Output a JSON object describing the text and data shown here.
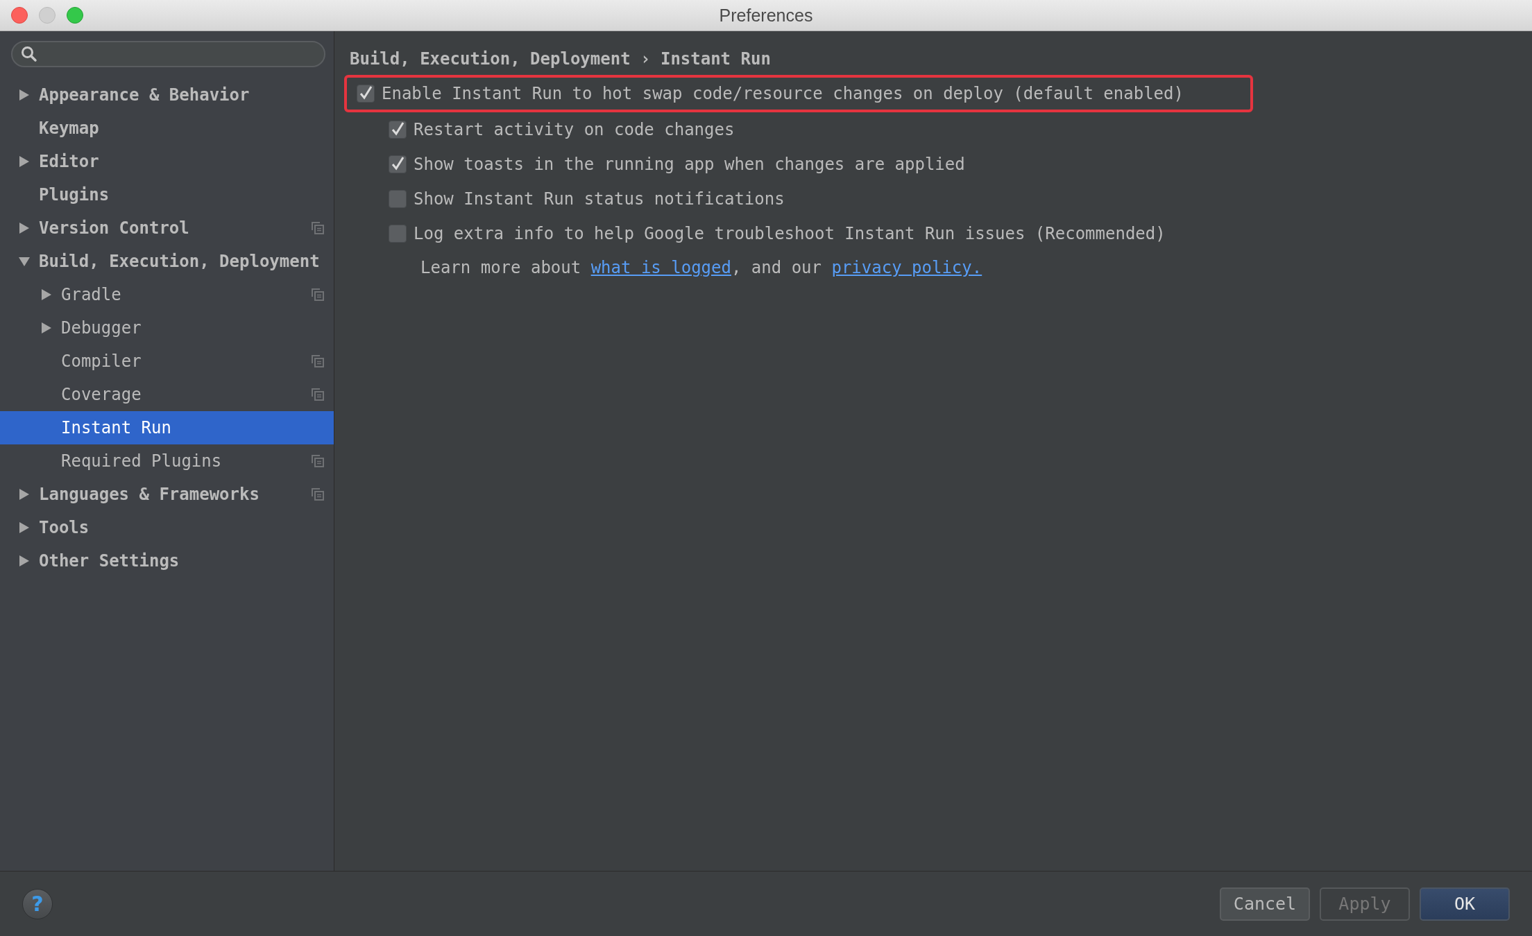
{
  "window": {
    "title": "Preferences"
  },
  "sidebar": {
    "items": [
      {
        "label": "Appearance & Behavior",
        "kind": "node",
        "expanded": false,
        "selected": false,
        "project_icon": false
      },
      {
        "label": "Keymap",
        "kind": "leaf",
        "selected": false,
        "project_icon": false
      },
      {
        "label": "Editor",
        "kind": "node",
        "expanded": false,
        "selected": false,
        "project_icon": false
      },
      {
        "label": "Plugins",
        "kind": "leaf",
        "selected": false,
        "project_icon": false
      },
      {
        "label": "Version Control",
        "kind": "node",
        "expanded": false,
        "selected": false,
        "project_icon": true
      },
      {
        "label": "Build, Execution, Deployment",
        "kind": "node",
        "expanded": true,
        "selected": false,
        "project_icon": false,
        "children": [
          {
            "label": "Gradle",
            "kind": "node",
            "expanded": false,
            "selected": false,
            "project_icon": true
          },
          {
            "label": "Debugger",
            "kind": "node",
            "expanded": false,
            "selected": false,
            "project_icon": false
          },
          {
            "label": "Compiler",
            "kind": "leaf",
            "selected": false,
            "project_icon": true
          },
          {
            "label": "Coverage",
            "kind": "leaf",
            "selected": false,
            "project_icon": true
          },
          {
            "label": "Instant Run",
            "kind": "leaf",
            "selected": true,
            "project_icon": false
          },
          {
            "label": "Required Plugins",
            "kind": "leaf",
            "selected": false,
            "project_icon": true
          }
        ]
      },
      {
        "label": "Languages & Frameworks",
        "kind": "node",
        "expanded": false,
        "selected": false,
        "project_icon": true
      },
      {
        "label": "Tools",
        "kind": "node",
        "expanded": false,
        "selected": false,
        "project_icon": false
      },
      {
        "label": "Other Settings",
        "kind": "node",
        "expanded": false,
        "selected": false,
        "project_icon": false
      }
    ]
  },
  "content": {
    "breadcrumb": "Build, Execution, Deployment › Instant Run",
    "options": [
      {
        "label": "Enable Instant Run to hot swap code/resource changes on deploy (default enabled)",
        "checked": true,
        "highlighted": true,
        "children": [
          {
            "label": "Restart activity on code changes",
            "checked": true,
            "highlighted": false
          },
          {
            "label": "Show toasts in the running app when changes are applied",
            "checked": true,
            "highlighted": false
          },
          {
            "label": "Show Instant Run status notifications",
            "checked": false,
            "highlighted": false
          },
          {
            "label": "Log extra info to help Google troubleshoot Instant Run issues (Recommended)",
            "checked": false,
            "highlighted": false
          }
        ]
      }
    ],
    "note": [
      {
        "kind": "text",
        "text": "Learn more about "
      },
      {
        "kind": "link",
        "text": "what is logged"
      },
      {
        "kind": "text",
        "text": ", and our "
      },
      {
        "kind": "link",
        "text": "privacy policy."
      }
    ]
  },
  "footer": {
    "help_button": "?",
    "buttons": [
      {
        "label": "Cancel",
        "disabled": false,
        "default": false
      },
      {
        "label": "Apply",
        "disabled": true,
        "default": false
      },
      {
        "label": "OK",
        "disabled": false,
        "default": true
      }
    ]
  }
}
